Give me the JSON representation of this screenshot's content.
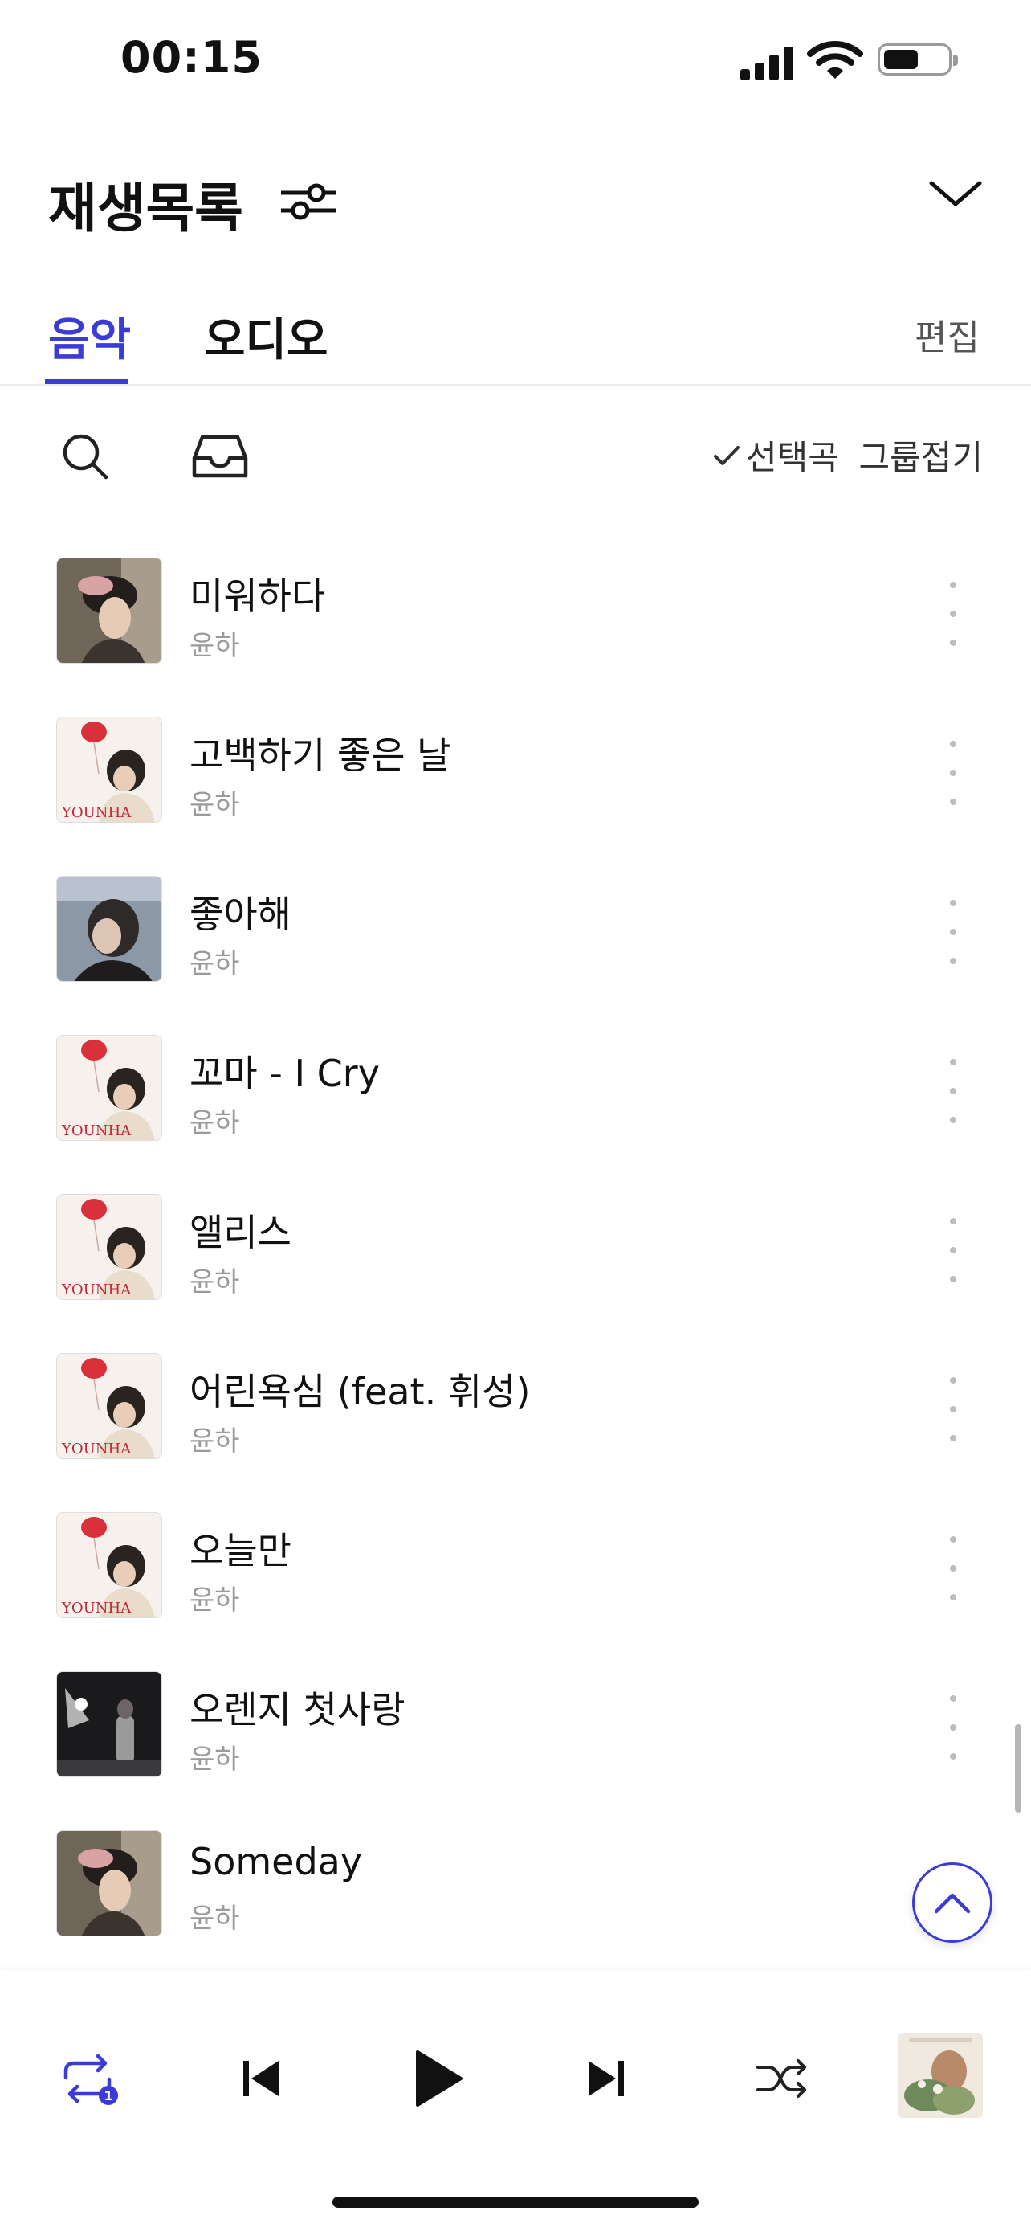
{
  "status_bar": {
    "time": "00:15",
    "battery_level": 0.55
  },
  "header": {
    "title": "재생목록"
  },
  "tabs": [
    {
      "label": "음악",
      "active": true
    },
    {
      "label": "오디오",
      "active": false
    }
  ],
  "edit_label": "편집",
  "toolbar": {
    "select_label": "선택곡",
    "group_label": "그룹접기"
  },
  "songs": [
    {
      "title": "미워하다",
      "artist": "윤하",
      "art": "portrait-pink"
    },
    {
      "title": "고백하기 좋은 날",
      "artist": "윤하",
      "art": "younha-balloon"
    },
    {
      "title": "좋아해",
      "artist": "윤하",
      "art": "portrait-blue"
    },
    {
      "title": "꼬마 - I Cry",
      "artist": "윤하",
      "art": "younha-balloon"
    },
    {
      "title": "앨리스",
      "artist": "윤하",
      "art": "younha-balloon"
    },
    {
      "title": "어린욕심 (feat. 휘성)",
      "artist": "윤하",
      "art": "younha-balloon"
    },
    {
      "title": "오늘만",
      "artist": "윤하",
      "art": "younha-balloon"
    },
    {
      "title": "오렌지 첫사랑",
      "artist": "윤하",
      "art": "dark-stage"
    },
    {
      "title": "Someday",
      "artist": "윤하",
      "art": "portrait-pink"
    }
  ],
  "album_text": {
    "younha": "YOUNHA"
  },
  "player": {
    "repeat_count": "1"
  },
  "colors": {
    "accent": "#3b3bd6",
    "muted": "#9a9a9a"
  },
  "icons": [
    "search-icon",
    "inbox-icon",
    "check-icon",
    "filter-icon",
    "chevron-down-icon",
    "more-vertical-icon",
    "arrow-up-icon",
    "repeat-one-icon",
    "previous-icon",
    "play-icon",
    "next-icon",
    "shuffle-icon"
  ]
}
